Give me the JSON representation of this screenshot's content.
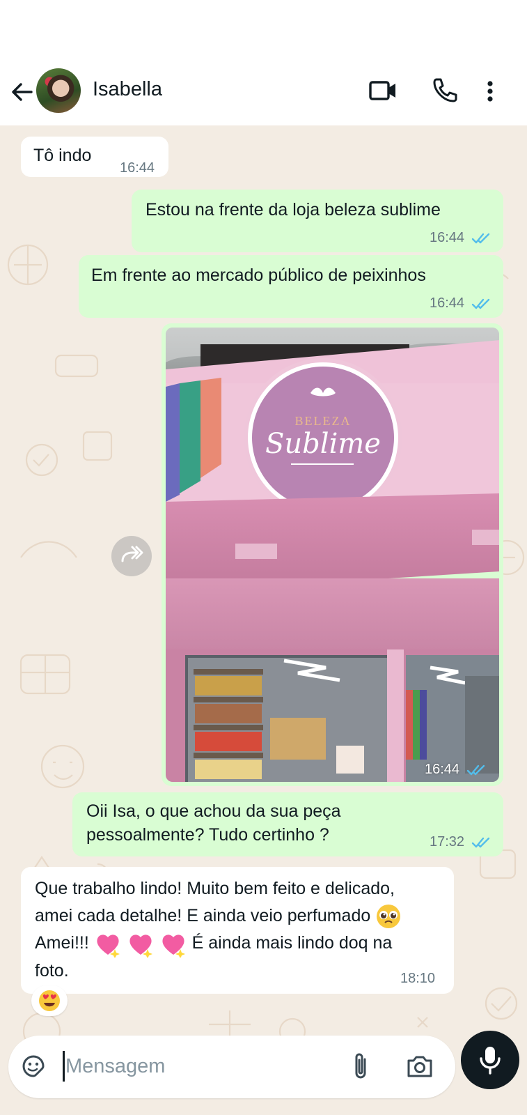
{
  "header": {
    "contact_name": "Isabella",
    "icons": [
      "back-arrow-icon",
      "avatar",
      "video-call-icon",
      "voice-call-icon",
      "more-vert-icon"
    ]
  },
  "messages": [
    {
      "direction": "in",
      "text": "Tô indo",
      "time": "16:44"
    },
    {
      "direction": "out",
      "text": "Estou na frente da loja beleza sublime",
      "time": "16:44",
      "status": "read"
    },
    {
      "direction": "out",
      "text": "Em  frente ao mercado público de peixinhos",
      "time": "16:44",
      "status": "read"
    },
    {
      "direction": "out",
      "type": "image",
      "image_sign_text": [
        "BELEZA",
        "Sublime"
      ],
      "time": "16:44",
      "status": "read"
    },
    {
      "direction": "out",
      "text": "Oii Isa, o que achou da sua peça pessoalmente? Tudo certinho ?",
      "time": "17:32",
      "status": "read"
    },
    {
      "direction": "in",
      "text_parts": [
        "Que trabalho lindo! Muito bem feito e delicado, amei cada detalhe! E ainda veio perfumado",
        "Amei!!!",
        "É ainda mais lindo doq na foto."
      ],
      "inline_emojis": [
        "pleading-face",
        "sparkling-heart",
        "sparkling-heart",
        "sparkling-heart"
      ],
      "time": "18:10",
      "reaction": "heart-eyes"
    }
  ],
  "composer": {
    "placeholder": "Mensagem",
    "value": ""
  },
  "colors": {
    "outgoing_bubble": "#d9fdd3",
    "incoming_bubble": "#ffffff",
    "wallpaper": "#f3ece3",
    "read_ticks": "#53bdeb",
    "mic_button": "#111b21"
  }
}
